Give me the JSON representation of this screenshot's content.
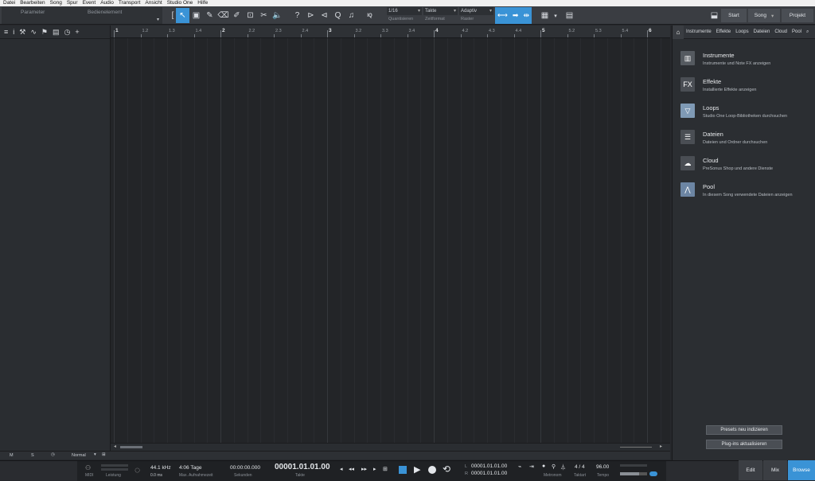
{
  "menu": [
    "Datei",
    "Bearbeiten",
    "Song",
    "Spur",
    "Event",
    "Audio",
    "Transport",
    "Ansicht",
    "Studio One",
    "Hilfe"
  ],
  "toolbar": {
    "parameter_label": "Parameter",
    "bedien_label": "Bedienelement",
    "quantize_value": "1/16",
    "quantize_label": "Quantisieren",
    "timeformat_value": "Takte",
    "timeformat_label": "Zeitformat",
    "snap_value": "Adaptiv",
    "snap_label": "Raster",
    "iq_label": "IQ",
    "start_label": "Start",
    "song_label": "Song",
    "project_label": "Projekt"
  },
  "ruler": {
    "bars": [
      "1",
      "2",
      "3",
      "4",
      "5",
      "6"
    ],
    "subdivisions": [
      "1.2",
      "1.3",
      "1.4",
      "2.2",
      "2.3",
      "2.4",
      "3.2",
      "3.3",
      "3.4",
      "4.2",
      "4.3",
      "4.4",
      "5.2",
      "5.3",
      "5.4"
    ]
  },
  "browser": {
    "tabs": [
      "Instrumente",
      "Effekte",
      "Loops",
      "Dateien",
      "Cloud",
      "Pool"
    ],
    "items": [
      {
        "title": "Instrumente",
        "desc": "Instrumente und Note FX anzeigen",
        "icon": "piano-icon",
        "color": "#555a60"
      },
      {
        "title": "Effekte",
        "desc": "Installierte Effekte anzeigen",
        "icon": "fx-icon",
        "color": "#4a4e54"
      },
      {
        "title": "Loops",
        "desc": "Studio One Loop-Bibliotheken durchsuchen",
        "icon": "loops-icon",
        "color": "#7f9ab5"
      },
      {
        "title": "Dateien",
        "desc": "Dateien und Ordner durchsuchen",
        "icon": "files-icon",
        "color": "#4a4e54"
      },
      {
        "title": "Cloud",
        "desc": "PreSonus Shop und andere Dienste",
        "icon": "cloud-icon",
        "color": "#4a4e54"
      },
      {
        "title": "Pool",
        "desc": "In diesem Song verwendete Dateien anzeigen",
        "icon": "pool-icon",
        "color": "#6c85a3"
      }
    ],
    "btn_rescan": "Presets neu indizieren",
    "btn_plugins": "Plug-ins aktualisieren"
  },
  "trackfooter": {
    "m": "M",
    "s": "S",
    "mode": "Normal"
  },
  "transport": {
    "midi": "MIDI",
    "perf": "Leistung",
    "samplerate": "44.1 kHz",
    "latency": "0.0 ms",
    "rec_days": "4:06 Tage",
    "rec_label": "Max. Aufnahmezeit",
    "seconds": "00:00:00.000",
    "seconds_label": "Sekunden",
    "bars": "00001.01.01.00",
    "bars_label": "Takte",
    "loop_l": "00001.01.01.00",
    "loop_r": "00001.01.01.00",
    "l": "L",
    "r": "R",
    "metronome": "Metronom",
    "timesig": "4 / 4",
    "timesig_label": "Taktart",
    "tempo": "96.00",
    "tempo_label": "Tempo"
  },
  "bottom_tabs": {
    "edit": "Edit",
    "mix": "Mix",
    "browse": "Browse"
  },
  "colors": {
    "accent": "#3a93d6"
  }
}
